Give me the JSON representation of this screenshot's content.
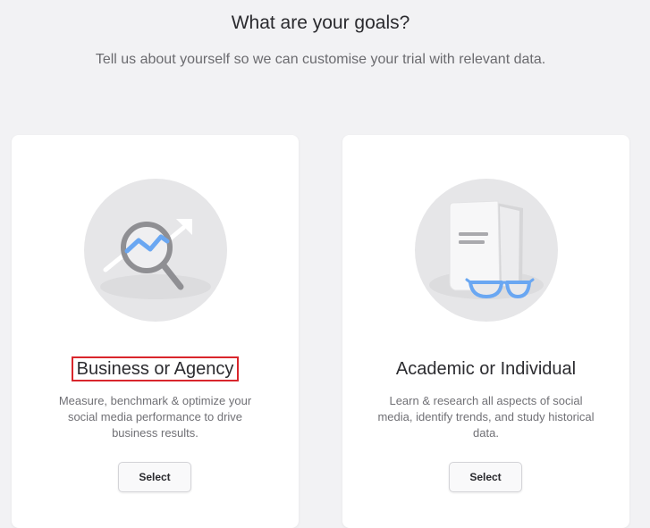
{
  "header": {
    "title": "What are your goals?",
    "subtitle": "Tell us about yourself so we can customise your trial with relevant data."
  },
  "cards": [
    {
      "title": "Business or Agency",
      "description": "Measure, benchmark & optimize your social media performance to drive business results.",
      "button_label": "Select",
      "illustration": "magnifier-trend-icon",
      "highlighted": true
    },
    {
      "title": "Academic or Individual",
      "description": "Learn & research all aspects of social media, identify trends, and study historical data.",
      "button_label": "Select",
      "illustration": "book-glasses-icon",
      "highlighted": false
    }
  ],
  "colors": {
    "page_background": "#f2f2f4",
    "card_background": "#ffffff",
    "accent_blue": "#6aa7f2",
    "highlight_border": "#d9262c"
  }
}
